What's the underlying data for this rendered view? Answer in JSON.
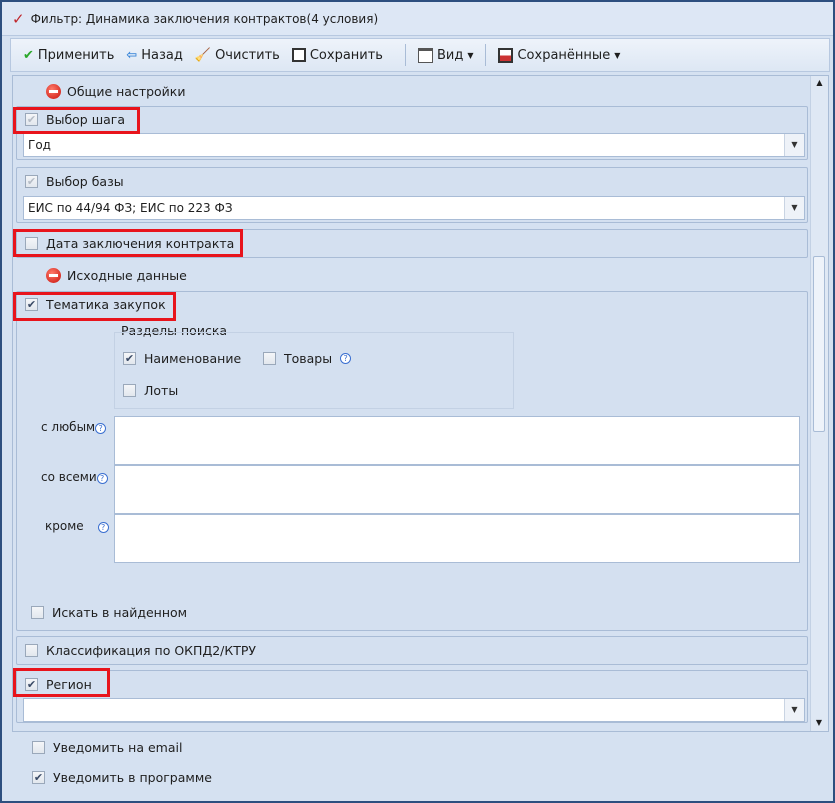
{
  "window": {
    "title": "Фильтр: Динамика заключения контрактов(4 условия)"
  },
  "toolbar": {
    "apply": "Применить",
    "back": "Назад",
    "clear": "Очистить",
    "save": "Сохранить",
    "view": "Вид",
    "saved": "Сохранённые"
  },
  "sections": {
    "general": "Общие настройки",
    "source": "Исходные данные"
  },
  "step": {
    "label": "Выбор шага",
    "checked": true,
    "value": "Год"
  },
  "base": {
    "label": "Выбор базы",
    "checked": true,
    "value": "ЕИС по 44/94 ФЗ; ЕИС по 223 ФЗ"
  },
  "date": {
    "label": "Дата заключения контракта",
    "checked": false
  },
  "topic": {
    "label": "Тематика закупок",
    "checked": true,
    "search_sections": "Разделы поиска",
    "name": {
      "label": "Наименование",
      "checked": true
    },
    "goods": {
      "label": "Товары",
      "checked": false
    },
    "lots": {
      "label": "Лоты",
      "checked": false
    },
    "any": "с любым",
    "all": "со всеми",
    "except": "кроме",
    "search_in_found": "Искать в найденном"
  },
  "okpd": {
    "label": "Классификация по ОКПД2/КТРУ",
    "checked": false
  },
  "region": {
    "label": "Регион",
    "checked": true,
    "value": ""
  },
  "notify": {
    "email": "Уведомить на email",
    "email_checked": false,
    "program": "Уведомить в программе",
    "program_checked": true
  }
}
